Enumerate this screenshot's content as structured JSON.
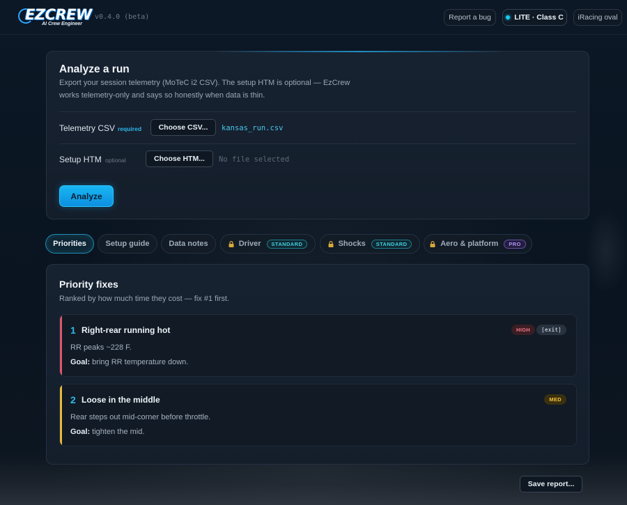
{
  "header": {
    "logo_text": "EZCREW",
    "logo_subtitle": "AI Crew Engineer",
    "version": "v0.4.0 (beta)",
    "report_bug": "Report a bug",
    "tier": "LITE · Class C",
    "track": "iRacing oval"
  },
  "analyze": {
    "title": "Analyze a run",
    "description": "Export your session telemetry (MoTeC i2 CSV). The setup HTM is optional — EzCrew works telemetry-only and says so honestly when data is thin.",
    "telemetry": {
      "label": "Telemetry CSV",
      "tag": "required",
      "button": "Choose CSV...",
      "value": "kansas_run.csv"
    },
    "setup": {
      "label": "Setup HTM",
      "tag": "optional",
      "button": "Choose HTM...",
      "value": "No file selected"
    },
    "analyze_button": "Analyze"
  },
  "tabs": [
    {
      "label": "Priorities",
      "active": true
    },
    {
      "label": "Setup guide"
    },
    {
      "label": "Data notes"
    },
    {
      "label": "Driver",
      "locked": true,
      "badge": "STANDARD"
    },
    {
      "label": "Shocks",
      "locked": true,
      "badge": "STANDARD"
    },
    {
      "label": "Aero & platform",
      "locked": true,
      "badge": "PRO"
    }
  ],
  "priority": {
    "title": "Priority fixes",
    "subtitle": "Ranked by how much time they cost — fix #1 first.",
    "goal_label": "Goal:",
    "fixes": [
      {
        "rank": "1",
        "title": "Right-rear running hot",
        "detail": "RR peaks ~228 F.",
        "goal": " bring RR temperature down.",
        "severity": "HIGH",
        "phase": "[exit]",
        "color": "#e0556e"
      },
      {
        "rank": "2",
        "title": "Loose in the middle",
        "detail": "Rear steps out mid-corner before throttle.",
        "goal": " tighten the mid.",
        "severity": "MED",
        "color": "#e8b93a"
      }
    ]
  },
  "save_button": "Save report...",
  "colors": {
    "accent": "#1cb4f0",
    "high": "#e0556e",
    "med": "#e8b93a",
    "standard_badge": "#3fd1e0",
    "pro_badge": "#b590ff"
  }
}
